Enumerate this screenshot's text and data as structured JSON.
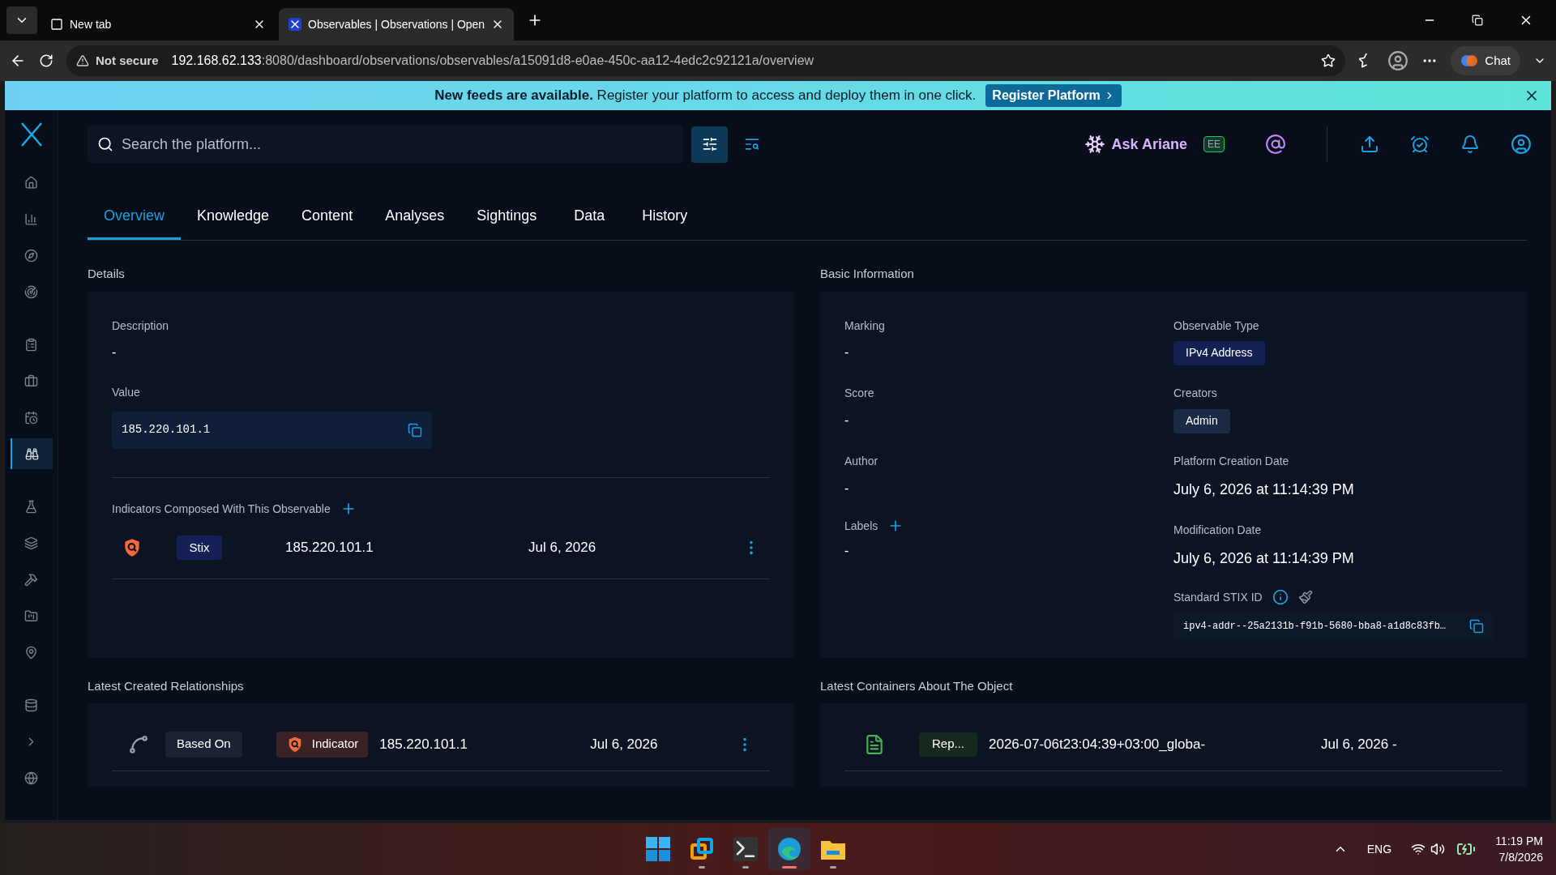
{
  "browser": {
    "tabs": [
      {
        "title": "New tab",
        "selected": false
      },
      {
        "title": "Observables | Observations | Open",
        "selected": true
      }
    ],
    "security": "Not secure",
    "url_host": "192.168.62.133",
    "url_path": ":8080/dashboard/observations/observables/a15091d8-e0ae-450c-aa12-4edc2c92121a/overview",
    "chat": "Chat"
  },
  "banner": {
    "text": "**New feeds are available.** Register your platform to access and deploy them in one click.",
    "button": "Register Platform"
  },
  "sidebar": {
    "items": [
      {
        "kind": "home",
        "selected": false
      },
      {
        "kind": "chart",
        "selected": false
      },
      {
        "kind": "compass",
        "selected": false
      },
      {
        "kind": "radar",
        "selected": false
      },
      {
        "kind": "clipboard",
        "selected": false
      },
      {
        "kind": "briefcase",
        "selected": false
      },
      {
        "kind": "calendar",
        "selected": false
      },
      {
        "kind": "binoculars",
        "selected": true
      },
      {
        "kind": "flask",
        "selected": false
      },
      {
        "kind": "layers",
        "selected": false
      },
      {
        "kind": "tools",
        "selected": false
      },
      {
        "kind": "folder",
        "selected": false
      },
      {
        "kind": "globe-pin",
        "selected": false
      },
      {
        "kind": "database",
        "selected": false
      },
      {
        "kind": "expand",
        "selected": false
      },
      {
        "kind": "globe",
        "selected": false
      }
    ]
  },
  "topbar": {
    "search_placeholder": "Search the platform...",
    "assistant": "Ask Ariane",
    "edition_badge": "EE"
  },
  "tabs": [
    {
      "label": "Overview",
      "selected": true
    },
    {
      "label": "Knowledge",
      "selected": false
    },
    {
      "label": "Content",
      "selected": false
    },
    {
      "label": "Analyses",
      "selected": false
    },
    {
      "label": "Sightings",
      "selected": false
    },
    {
      "label": "Data",
      "selected": false
    },
    {
      "label": "History",
      "selected": false
    }
  ],
  "details": {
    "title": "Details",
    "description_label": "Description",
    "description": "-",
    "value_label": "Value",
    "value": "185.220.101.1",
    "indicators_title": "Indicators Composed With This Observable",
    "indicators": [
      {
        "pattern_type": "Stix",
        "name": "185.220.101.1",
        "date": "Jul 6, 2026"
      }
    ]
  },
  "basic_information": {
    "title": "Basic Information",
    "marking_label": "Marking",
    "marking": "-",
    "score_label": "Score",
    "score": "-",
    "author_label": "Author",
    "author": "-",
    "labels_label": "Labels",
    "labels": "-",
    "type_label": "Observable Type",
    "type": "IPv4 Address",
    "creators_label": "Creators",
    "creators": [
      "Admin"
    ],
    "created_label": "Platform Creation Date",
    "created": "July 6, 2026 at 11:14:39 PM",
    "modified_label": "Modification Date",
    "modified": "July 6, 2026 at 11:14:39 PM",
    "stix_label": "Standard STIX ID",
    "stix_id": "ipv4-addr--25a2131b-f91b-5680-bba8-a1d8c83fb…"
  },
  "relationships": {
    "title": "Latest Created Relationships",
    "rows": [
      {
        "relation": "Based On",
        "entity_type": "Indicator",
        "name": "185.220.101.1",
        "date": "Jul 6, 2026"
      }
    ]
  },
  "containers": {
    "title": "Latest Containers About The Object",
    "rows": [
      {
        "type": "Rep...",
        "name": "2026-07-06t23:04:39+03:00_globa-",
        "date": "Jul 6, 2026 -"
      }
    ]
  },
  "taskbar": {
    "apps": [
      {
        "kind": "start",
        "selected": false,
        "running": false
      },
      {
        "kind": "remote",
        "selected": false,
        "running": true
      },
      {
        "kind": "terminal",
        "selected": false,
        "running": true
      },
      {
        "kind": "browser",
        "selected": true,
        "running": true
      },
      {
        "kind": "files",
        "selected": false,
        "running": true
      }
    ],
    "language": "ENG",
    "time": "11:19 PM",
    "date": "7/8/2026"
  }
}
